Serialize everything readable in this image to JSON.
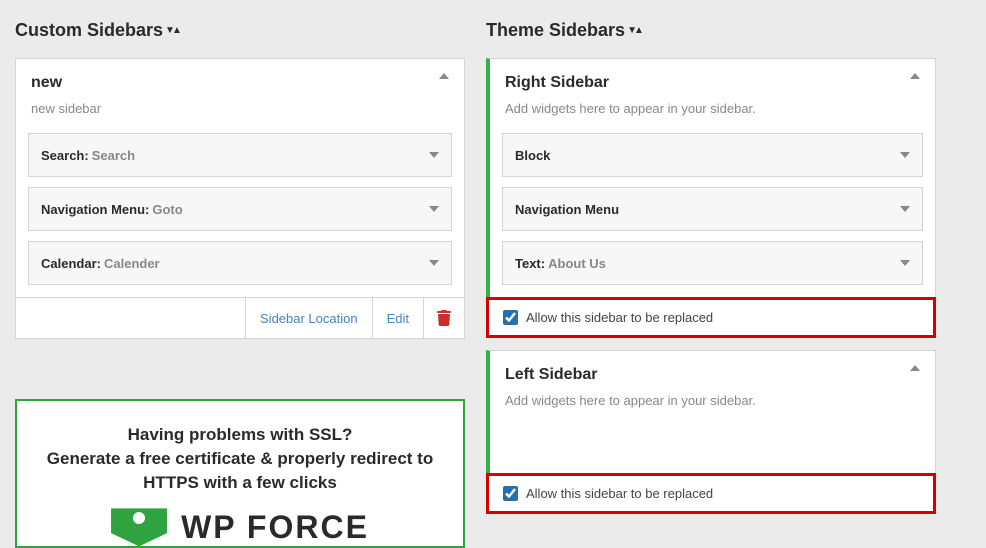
{
  "headings": {
    "custom": "Custom Sidebars",
    "theme": "Theme Sidebars"
  },
  "custom_panel": {
    "title": "new",
    "desc": "new sidebar",
    "widgets": [
      {
        "name": "Search",
        "value": "Search"
      },
      {
        "name": "Navigation Menu",
        "value": "Goto"
      },
      {
        "name": "Calendar",
        "value": "Calender"
      }
    ],
    "actions": {
      "location": "Sidebar Location",
      "edit": "Edit"
    }
  },
  "theme_panels": [
    {
      "title": "Right Sidebar",
      "desc": "Add widgets here to appear in your sidebar.",
      "widgets": [
        {
          "name": "Block",
          "value": null
        },
        {
          "name": "Navigation Menu",
          "value": null
        },
        {
          "name": "Text",
          "value": "About Us"
        }
      ],
      "allow_label": "Allow this sidebar to be replaced",
      "allow_checked": true
    },
    {
      "title": "Left Sidebar",
      "desc": "Add widgets here to appear in your sidebar.",
      "widgets": [],
      "allow_label": "Allow this sidebar to be replaced",
      "allow_checked": true
    }
  ],
  "promo": {
    "line1": "Having problems with SSL?",
    "line2": "Generate a free certificate & properly redirect to HTTPS with a few clicks",
    "brand": "WP FORCE"
  }
}
